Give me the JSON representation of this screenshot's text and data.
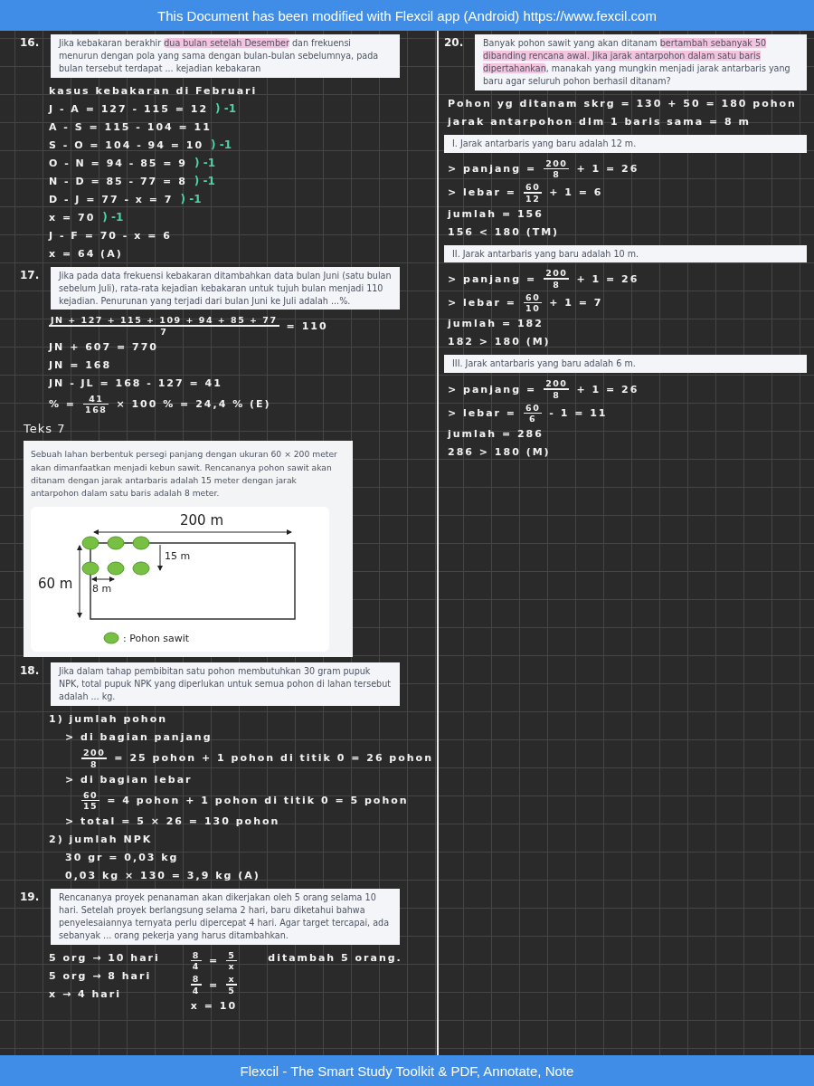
{
  "header": {
    "text": "This Document has been modified with Flexcil app (Android) https://www.fexcil.com"
  },
  "left_column": [
    {
      "kind": "question",
      "number": "16.",
      "segments": [
        {
          "text": "Jika kebakaran berakhir ",
          "highlighted": false
        },
        {
          "text": "dua bulan setelah Desember",
          "highlighted": true
        },
        {
          "text": " dan frekuensi menurun dengan pola yang sama dengan bulan-bulan sebelumnya, pada bulan tersebut terdapat ... kejadian kebakaran",
          "highlighted": false
        }
      ]
    },
    {
      "kind": "work",
      "columns": [
        [
          {
            "text": "kasus kebakaran di Februari"
          },
          {
            "text": "J - A = 127 - 115 = 12",
            "note": ") -1"
          },
          {
            "text": "A - S = 115 - 104 = 11"
          },
          {
            "text": "S - O = 104 - 94 = 10",
            "note": ") -1"
          },
          {
            "text": "O - N = 94 - 85 = 9",
            "note": ") -1"
          },
          {
            "text": "N - D = 85 - 77 = 8",
            "note": ") -1"
          },
          {
            "text": "D - J = 77 - x = 7",
            "note": ") -1"
          },
          {
            "text": "x = 70",
            "note": ") -1"
          },
          {
            "text": "J - F = 70 - x = 6"
          },
          {
            "text": "x = 64 (A)"
          }
        ]
      ]
    },
    {
      "kind": "question",
      "number": "17.",
      "text": "Jika pada data frekuensi kebakaran ditambahkan data bulan Juni (satu bulan sebelum Juli), rata-rata kejadian kebakaran untuk tujuh bulan menjadi 110 kejadian. Penurunan yang terjadi dari bulan Juni ke Juli adalah ...%."
    },
    {
      "kind": "work",
      "columns": [
        [
          {
            "tokens": [
              {
                "kind": "fraction",
                "num": "JN + 127 + 115 + 109 + 94 + 85 + 77",
                "den": "7"
              },
              {
                "kind": "text",
                "text": "= 110"
              }
            ]
          },
          {
            "text": "JN + 607 = 770"
          },
          {
            "text": "JN = 168"
          },
          {
            "text": "JN - JL = 168 - 127 = 41"
          },
          {
            "tokens": [
              {
                "kind": "text",
                "text": "% ="
              },
              {
                "kind": "fraction",
                "num": "41",
                "den": "168"
              },
              {
                "kind": "text",
                "text": "× 100 % = 24,4 % (E)"
              }
            ]
          }
        ]
      ]
    },
    {
      "kind": "heading",
      "text": "Teks 7"
    },
    {
      "kind": "figure",
      "text": "Sebuah lahan berbentuk persegi panjang dengan ukuran 60 × 200 meter akan dimanfaatkan menjadi kebun sawit. Rencananya pohon sawit akan ditanam dengan jarak antarbaris adalah 15 meter dengan jarak antarpohon dalam satu baris adalah 8 meter.",
      "labels": [
        "200 m",
        "15 m",
        "60 m",
        "8 m"
      ],
      "legend": ": Pohon sawit"
    },
    {
      "kind": "question",
      "number": "18.",
      "text": "Jika dalam tahap pembibitan satu pohon membutuhkan 30 gram pupuk NPK, total pupuk NPK yang diperlukan untuk semua pohon di lahan tersebut adalah ... kg."
    },
    {
      "kind": "work",
      "columns": [
        [
          {
            "text": "1) jumlah pohon",
            "children": [
              {
                "text": "> di bagian panjang",
                "children": [
                  {
                    "tokens": [
                      {
                        "kind": "fraction",
                        "num": "200",
                        "den": "8"
                      },
                      {
                        "kind": "text",
                        "text": "= 25 pohon + 1 pohon di titik 0 = 26 pohon"
                      }
                    ]
                  }
                ]
              },
              {
                "text": "> di bagian lebar",
                "children": [
                  {
                    "tokens": [
                      {
                        "kind": "fraction",
                        "num": "60",
                        "den": "15"
                      },
                      {
                        "kind": "text",
                        "text": "= 4 pohon + 1 pohon di titik 0 = 5 pohon"
                      }
                    ]
                  }
                ]
              },
              {
                "text": "> total = 5 × 26 = 130 pohon"
              }
            ]
          },
          {
            "text": "2) jumlah NPK",
            "children": [
              {
                "text": "30 gr = 0,03 kg"
              },
              {
                "text": "0,03 kg × 130 = 3,9 kg (A)"
              }
            ]
          }
        ]
      ]
    },
    {
      "kind": "question",
      "number": "19.",
      "text": "Rencananya proyek penanaman akan dikerjakan oleh 5 orang selama 10 hari. Setelah proyek berlangsung selama 2 hari, baru diketahui bahwa penyelesaiannya ternyata perlu dipercepat 4 hari. Agar target tercapai, ada sebanyak ... orang pekerja yang harus ditambahkan."
    },
    {
      "kind": "work",
      "columns": [
        [
          {
            "text": "5 org → 10 hari"
          },
          {
            "text": "5 org → 8 hari"
          },
          {
            "text": "x → 4 hari"
          }
        ],
        [
          {
            "tokens": [
              {
                "kind": "fraction",
                "num": "8",
                "den": "4"
              },
              {
                "kind": "text",
                "text": "="
              },
              {
                "kind": "fraction",
                "num": "5",
                "den": "x"
              }
            ]
          },
          {
            "tokens": [
              {
                "kind": "fraction",
                "num": "8",
                "den": "4"
              },
              {
                "kind": "text",
                "text": "="
              },
              {
                "kind": "fraction",
                "num": "x",
                "den": "5"
              }
            ]
          },
          {
            "text": "x = 10"
          }
        ],
        [
          {
            "text": "ditambah 5 orang."
          }
        ]
      ]
    }
  ],
  "right_column": [
    {
      "kind": "question",
      "number": "20.",
      "segments": [
        {
          "text": "Banyak pohon sawit yang akan ditanam ",
          "highlighted": false
        },
        {
          "text": "bertambah sebanyak 50 dibanding rencana awal. Jika jarak antarpohon dalam satu baris dipertahankan",
          "highlighted": true
        },
        {
          "text": ", manakah yang mungkin menjadi jarak antarbaris yang baru agar seluruh pohon berhasil ditanam?",
          "highlighted": false
        }
      ]
    },
    {
      "kind": "work",
      "columns": [
        [
          {
            "text": "Pohon yg ditanam skrg = 130 + 50 = 180 pohon"
          },
          {
            "text": "jarak antarpohon dlm 1 baris sama = 8 m"
          }
        ]
      ]
    },
    {
      "kind": "question",
      "text": "I. Jarak antarbaris yang baru adalah 12 m."
    },
    {
      "kind": "work",
      "columns": [
        [
          {
            "tokens": [
              {
                "kind": "text",
                "text": "> panjang ="
              },
              {
                "kind": "fraction",
                "num": "200",
                "den": "8"
              },
              {
                "kind": "text",
                "text": "+ 1 = 26"
              }
            ]
          },
          {
            "tokens": [
              {
                "kind": "text",
                "text": "> lebar ="
              },
              {
                "kind": "fraction",
                "num": "60",
                "den": "12"
              },
              {
                "kind": "text",
                "text": "+ 1 = 6"
              }
            ]
          },
          {
            "text": "jumlah = 156"
          },
          {
            "text": "156 < 180 (TM)"
          }
        ]
      ]
    },
    {
      "kind": "question",
      "text": "II. Jarak antarbaris yang baru adalah 10 m."
    },
    {
      "kind": "work",
      "columns": [
        [
          {
            "tokens": [
              {
                "kind": "text",
                "text": "> panjang ="
              },
              {
                "kind": "fraction",
                "num": "200",
                "den": "8"
              },
              {
                "kind": "text",
                "text": "+ 1 = 26"
              }
            ]
          },
          {
            "tokens": [
              {
                "kind": "text",
                "text": "> lebar ="
              },
              {
                "kind": "fraction",
                "num": "60",
                "den": "10"
              },
              {
                "kind": "text",
                "text": "+ 1 = 7"
              }
            ]
          },
          {
            "text": "jumlah = 182"
          },
          {
            "text": "182 > 180 (M)"
          }
        ]
      ]
    },
    {
      "kind": "question",
      "text": "III. Jarak antarbaris yang baru adalah 6 m."
    },
    {
      "kind": "work",
      "columns": [
        [
          {
            "tokens": [
              {
                "kind": "text",
                "text": "> panjang ="
              },
              {
                "kind": "fraction",
                "num": "200",
                "den": "8"
              },
              {
                "kind": "text",
                "text": "+ 1 = 26"
              }
            ]
          },
          {
            "tokens": [
              {
                "kind": "text",
                "text": "> lebar ="
              },
              {
                "kind": "fraction",
                "num": "60",
                "den": "6"
              },
              {
                "kind": "text",
                "text": "- 1 = 11"
              }
            ]
          },
          {
            "text": "jumlah = 286"
          },
          {
            "text": "286 > 180 (M)"
          }
        ]
      ]
    }
  ],
  "footer": {
    "text": "Flexcil - The Smart Study Toolkit & PDF, Annotate, Note"
  }
}
